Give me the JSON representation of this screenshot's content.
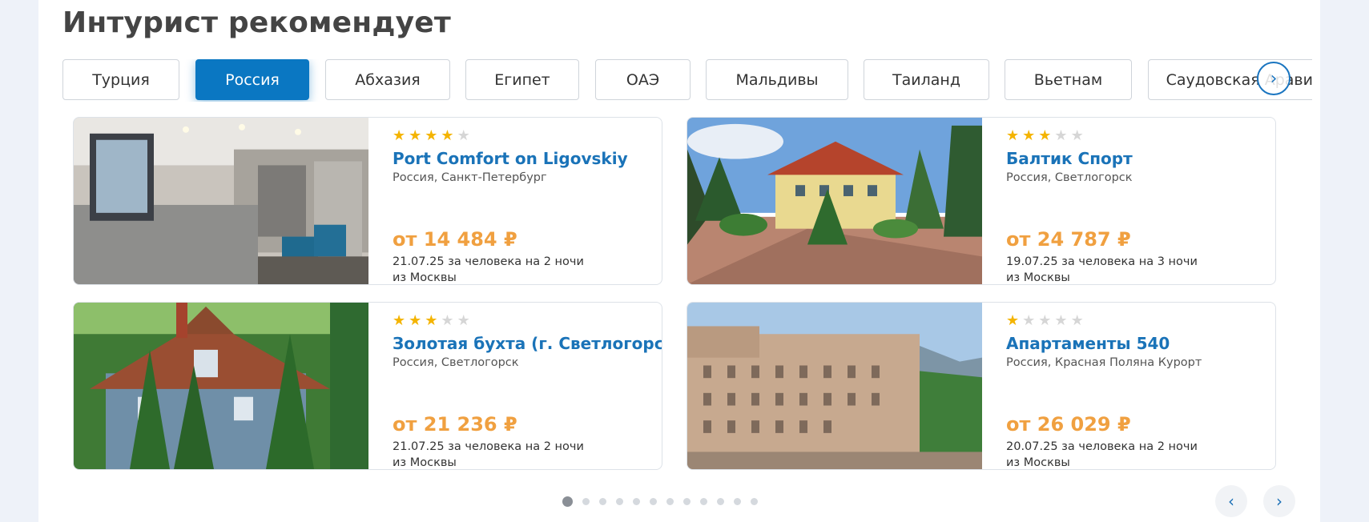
{
  "section": {
    "title": "Интурист рекомендует"
  },
  "tabs": [
    {
      "label": "Турция",
      "active": false
    },
    {
      "label": "Россия",
      "active": true
    },
    {
      "label": "Абхазия",
      "active": false
    },
    {
      "label": "Египет",
      "active": false
    },
    {
      "label": "ОАЭ",
      "active": false
    },
    {
      "label": "Мальдивы",
      "active": false
    },
    {
      "label": "Таиланд",
      "active": false
    },
    {
      "label": "Вьетнам",
      "active": false
    },
    {
      "label": "Саудовская Аравия",
      "active": false
    }
  ],
  "tabs_next_icon": "chevron-right-icon",
  "hotels": [
    {
      "stars": 4,
      "name": "Port Comfort on Ligovskiy",
      "location": "Россия, Санкт-Петербург",
      "price": "от 14 484 ₽",
      "terms": "21.07.25 за человека на 2 ночи",
      "departure": "из Москвы",
      "photo": "hotel-lobby-photo"
    },
    {
      "stars": 3,
      "name": "Балтик Спорт",
      "location": "Россия, Светлогорск",
      "price": "от 24 787 ₽",
      "terms": "19.07.25 за человека на 3 ночи",
      "departure": "из Москвы",
      "photo": "yellow-villa-photo"
    },
    {
      "stars": 3,
      "name": "Золотая бухта (г. Светлогорск)",
      "location": "Россия, Светлогорск",
      "price": "от 21 236 ₽",
      "terms": "21.07.25 за человека на 2 ночи",
      "departure": "из Москвы",
      "photo": "wooden-house-photo"
    },
    {
      "stars": 1,
      "name": "Апартаменты 540",
      "location": "Россия, Красная Поляна Курорт",
      "price": "от 26 029 ₽",
      "terms": "20.07.25 за человека на 2 ночи",
      "departure": "из Москвы",
      "photo": "mountain-resort-photo"
    }
  ],
  "pagination": {
    "total": 12,
    "current": 1
  },
  "nav": {
    "prev_icon": "chevron-left-icon",
    "next_icon": "chevron-right-icon"
  },
  "colors": {
    "accent": "#0a77c2",
    "hotel_name": "#1a73b8",
    "price": "#f0a040",
    "star_on": "#f4b400",
    "star_off": "#d6d6d6"
  }
}
